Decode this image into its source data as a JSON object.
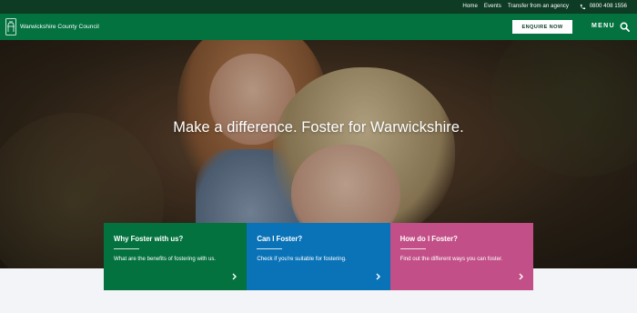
{
  "topbar": {
    "links": [
      "Home",
      "Events",
      "Transfer from an agency"
    ],
    "phone": "0800 408 1556"
  },
  "header": {
    "logo_text": "Warwickshire County Council",
    "enquire_label": "ENQUIRE NOW",
    "menu_label": "MENU"
  },
  "hero": {
    "heading": "Make a difference. Foster for Warwickshire."
  },
  "cards": [
    {
      "title": "Why Foster with us?",
      "text": "What are the benefits of fostering with us.",
      "color": "#03723f"
    },
    {
      "title": "Can I Foster?",
      "text": "Check if you're suitable for fostering.",
      "color": "#0a73b7"
    },
    {
      "title": "How do I Foster?",
      "text": "Find out the different ways you can foster.",
      "color": "#c24f87"
    }
  ],
  "colors": {
    "topbar": "#0d3b24",
    "header": "#03723f",
    "page_background": "#f3f4f7"
  },
  "icons": {
    "phone": "phone-icon",
    "search": "search-icon",
    "card_arrow": "chevron-right-icon",
    "logo": "bear-and-staff-logo"
  }
}
